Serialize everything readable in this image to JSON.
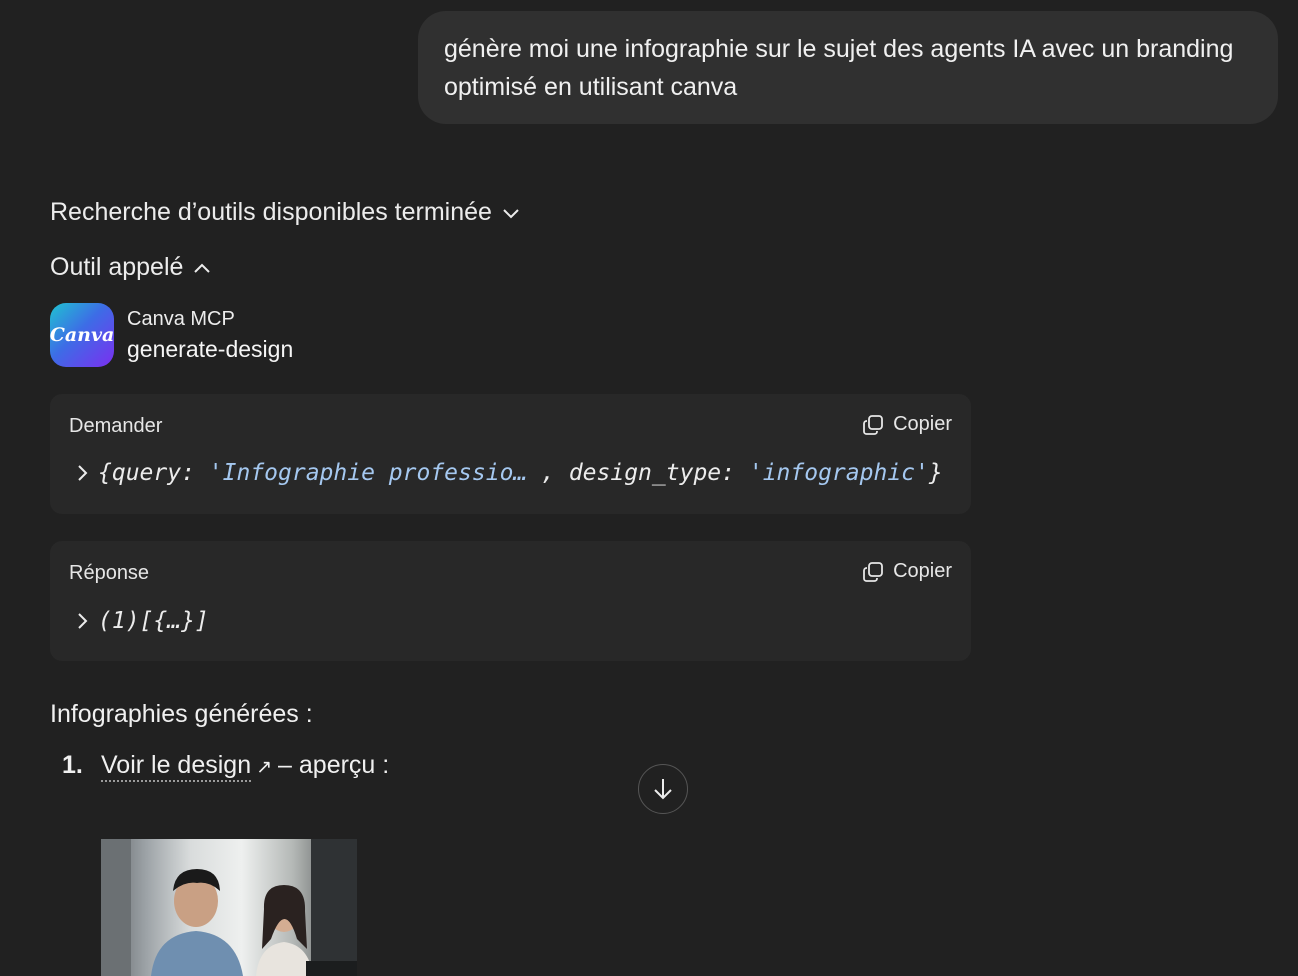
{
  "user_message": "génère moi une infographie sur le sujet des agents IA avec un branding optimisé en utilisant canva",
  "search_tools": {
    "label": "Recherche d’outils disponibles terminée",
    "icon": "chevron-down-icon"
  },
  "tool_called": {
    "label": "Outil appelé",
    "icon": "chevron-up-icon",
    "provider": "Canva MCP",
    "name": "generate-design",
    "logo_text": "Canva"
  },
  "request_card": {
    "label": "Demander",
    "copy_label": "Copier",
    "code": {
      "open": "{query: ",
      "query_value": "'Infographie professio… ",
      "sep": ", design_type: ",
      "type_value": "'infographic'",
      "close": "}"
    }
  },
  "response_card": {
    "label": "Réponse",
    "copy_label": "Copier",
    "code": "(1)[{…}]"
  },
  "results": {
    "title": "Infographies générées :",
    "items": [
      {
        "number": "1.",
        "link_label": "Voir le design",
        "suffix": " – aperçu :"
      }
    ]
  },
  "colors": {
    "background": "#212121",
    "bubble": "#303030",
    "card": "#282828",
    "string": "#a5c8f0"
  }
}
